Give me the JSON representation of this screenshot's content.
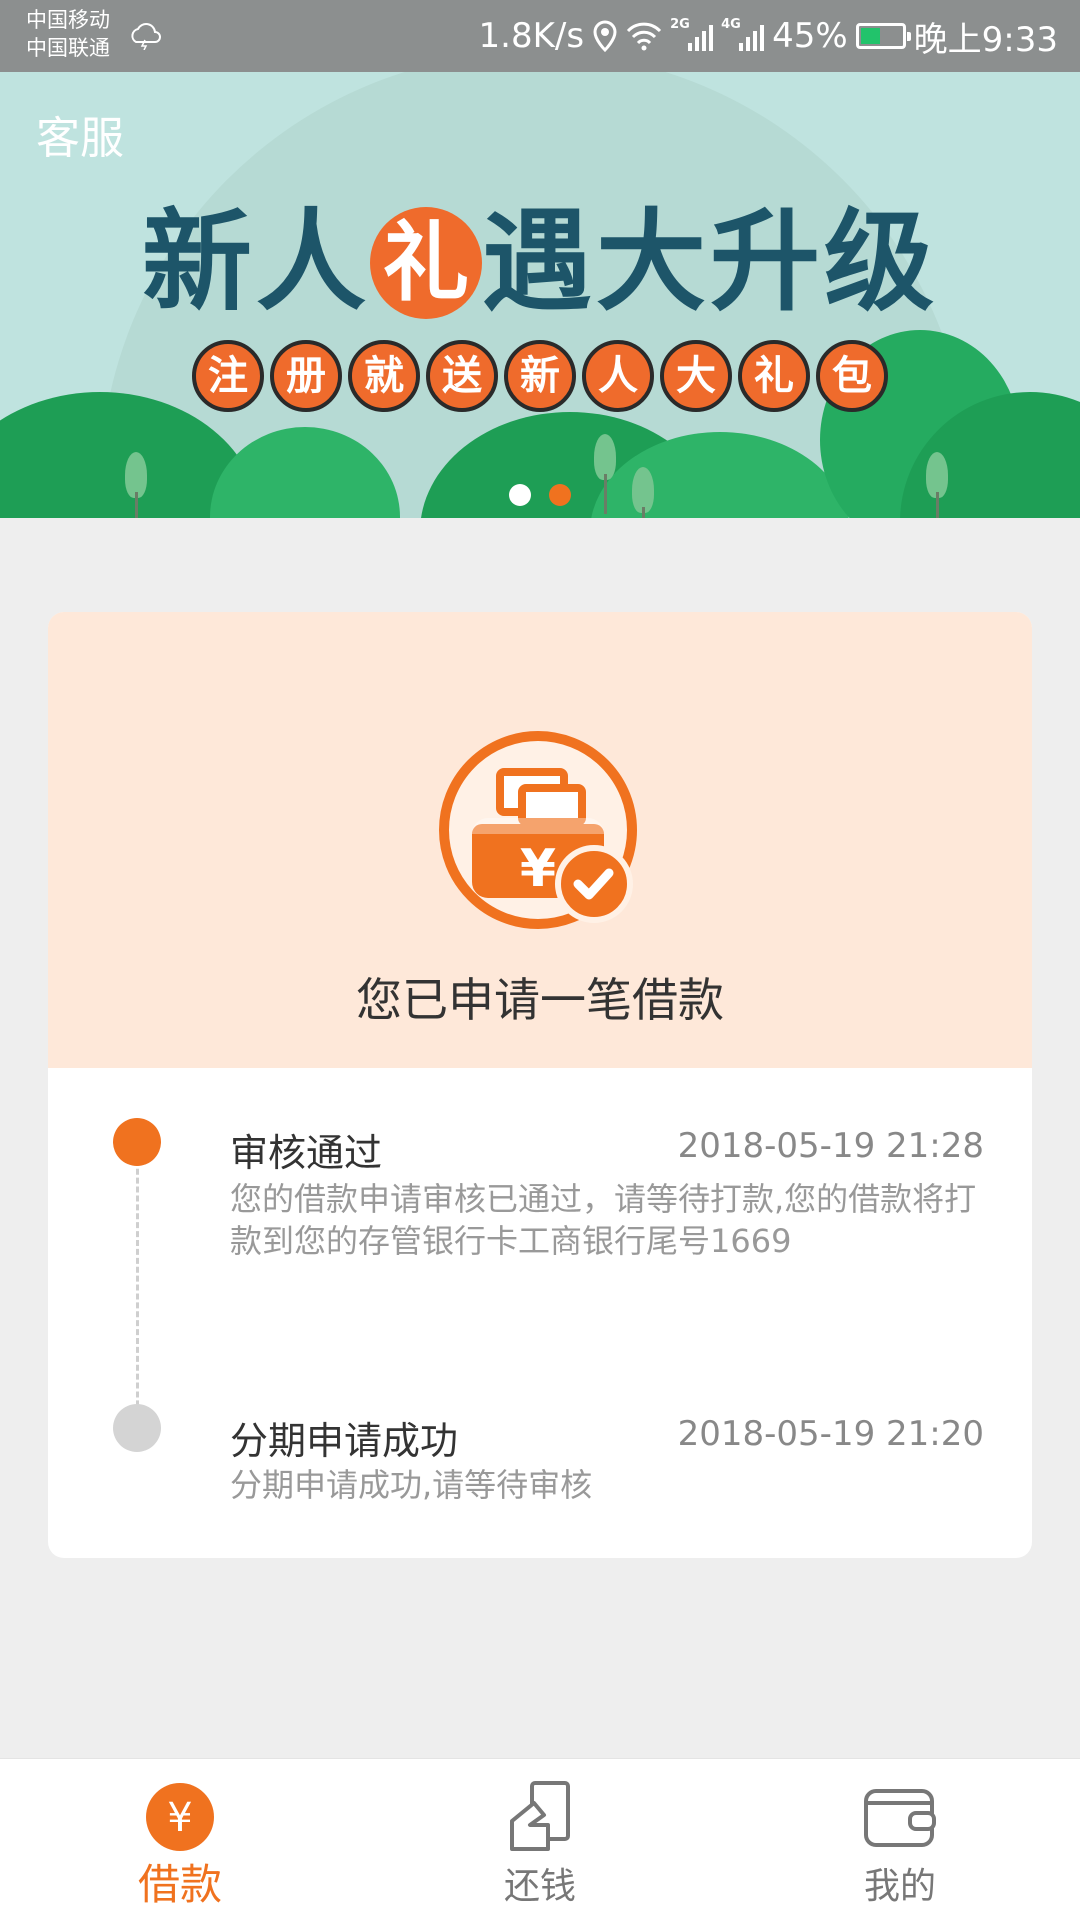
{
  "status_bar": {
    "carrier_1": "中国移动",
    "carrier_2": "中国联通",
    "net_speed": "1.8K/s",
    "signal_1_tag": "2G",
    "signal_2_tag": "4G",
    "battery": "45%",
    "time": "晚上9:33"
  },
  "banner": {
    "service_label": "客服",
    "title_part1": "新人",
    "title_gift_char": "礼",
    "title_part2": "遇大升级",
    "subtitle_chars": [
      "注",
      "册",
      "就",
      "送",
      "新",
      "人",
      "大",
      "礼",
      "包"
    ],
    "active_slide": 2,
    "slide_count": 2
  },
  "loan_status": {
    "headline": "您已申请一笔借款",
    "events": [
      {
        "title": "审核通过",
        "time": "2018-05-19 21:28",
        "desc": "您的借款申请审核已通过，请等待打款,您的借款将打款到您的存管银行卡工商银行尾号1669",
        "state": "active"
      },
      {
        "title": "分期申请成功",
        "time": "2018-05-19 21:20",
        "desc": "分期申请成功,请等待审核",
        "state": "done"
      }
    ]
  },
  "bottom_nav": {
    "items": [
      {
        "label": "借款",
        "icon": "yen-circle-icon",
        "active": true
      },
      {
        "label": "还钱",
        "icon": "repay-card-icon",
        "active": false
      },
      {
        "label": "我的",
        "icon": "wallet-icon",
        "active": false
      }
    ]
  },
  "colors": {
    "accent": "#f0721f",
    "banner_bg": "#bfe3df",
    "card_header_bg": "#fee8d9",
    "inactive_dot": "#d4d4d4"
  }
}
